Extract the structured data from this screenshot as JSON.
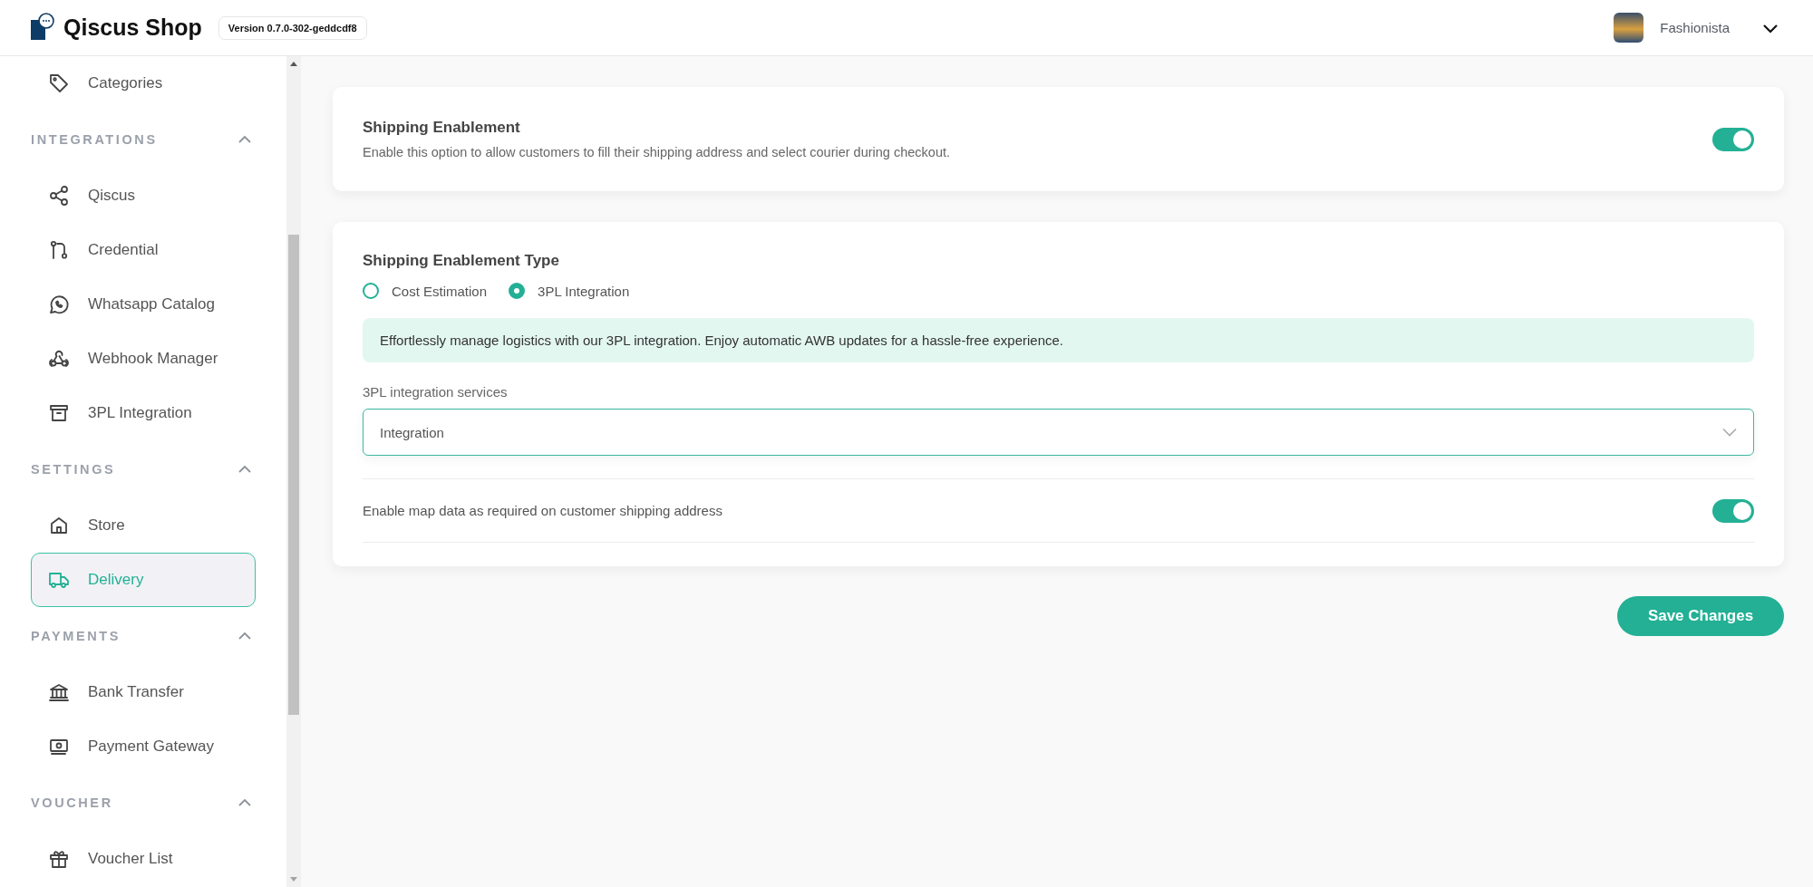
{
  "header": {
    "logo_text": "Qiscus Shop",
    "version": "Version 0.7.0-302-geddcdf8",
    "user_name": "Fashionista"
  },
  "sidebar": {
    "items": [
      {
        "label": "Categories",
        "selected": false
      }
    ],
    "sections": [
      {
        "title": "INTEGRATIONS",
        "expanded": true,
        "items": [
          {
            "label": "Qiscus",
            "selected": false
          },
          {
            "label": "Credential",
            "selected": false
          },
          {
            "label": "Whatsapp Catalog",
            "selected": false
          },
          {
            "label": "Webhook Manager",
            "selected": false
          },
          {
            "label": "3PL Integration",
            "selected": false
          }
        ]
      },
      {
        "title": "SETTINGS",
        "expanded": true,
        "items": [
          {
            "label": "Store",
            "selected": false
          },
          {
            "label": "Delivery",
            "selected": true
          }
        ]
      },
      {
        "title": "PAYMENTS",
        "expanded": true,
        "items": [
          {
            "label": "Bank Transfer",
            "selected": false
          },
          {
            "label": "Payment Gateway",
            "selected": false
          }
        ]
      },
      {
        "title": "VOUCHER",
        "expanded": true,
        "items": [
          {
            "label": "Voucher List",
            "selected": false
          }
        ]
      }
    ]
  },
  "shipping_enablement": {
    "title": "Shipping Enablement",
    "description": "Enable this option to allow customers to fill their shipping address and select courier during checkout.",
    "on": true
  },
  "shipping_type": {
    "title": "Shipping Enablement Type",
    "options": [
      {
        "label": "Cost Estimation",
        "selected": false
      },
      {
        "label": "3PL Integration",
        "selected": true
      }
    ],
    "info": "Effortlessly manage logistics with our 3PL integration. Enjoy automatic AWB updates for a hassle-free experience.",
    "services": {
      "label": "3PL integration services",
      "value": "Integration"
    },
    "map_data": {
      "label": "Enable map data as required on customer shipping address",
      "on": true
    }
  },
  "save_button": "Save Changes"
}
